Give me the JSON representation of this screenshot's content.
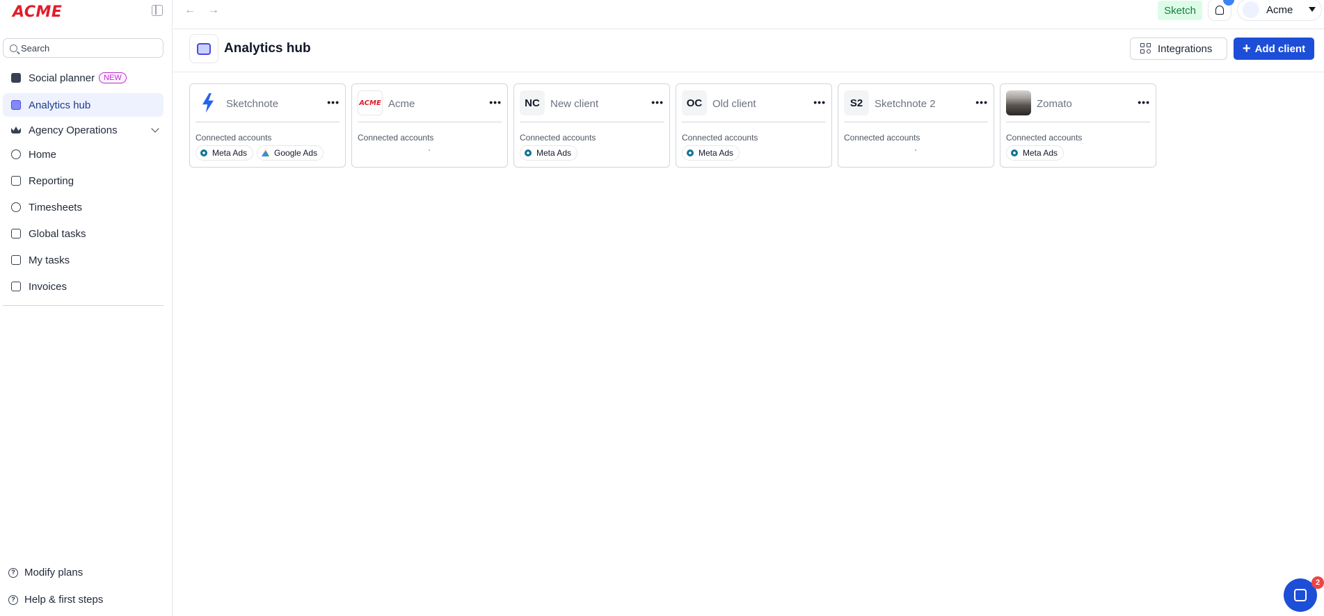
{
  "app": {
    "logo_text": "ACME",
    "brand_color": "#e11d2a",
    "accent_color": "#1d4ed8"
  },
  "sidebar": {
    "search_placeholder": "Search",
    "items": [
      {
        "label": "Social planner",
        "badge": "NEW",
        "icon": "calendar-icon"
      },
      {
        "label": "Analytics hub",
        "icon": "analytics-icon",
        "active": true
      },
      {
        "label": "Agency Operations",
        "icon": "crown-icon",
        "expandable": true
      },
      {
        "label": "Home",
        "icon": "home-icon"
      },
      {
        "label": "Reporting",
        "icon": "report-icon"
      },
      {
        "label": "Timesheets",
        "icon": "clock-icon"
      },
      {
        "label": "Global tasks",
        "icon": "tasks-icon"
      },
      {
        "label": "My tasks",
        "icon": "checklist-icon"
      },
      {
        "label": "Invoices",
        "icon": "invoice-icon"
      }
    ],
    "footer": [
      {
        "label": "Modify plans",
        "icon": "help-icon"
      },
      {
        "label": "Help & first steps",
        "icon": "help-icon"
      }
    ]
  },
  "topbar": {
    "workspace_tag": "Sketch",
    "account_name": "Acme"
  },
  "header": {
    "title": "Analytics hub",
    "integrations_label": "Integrations",
    "add_client_label": "Add client"
  },
  "clients": [
    {
      "name": "Sketchnote",
      "avatar": "logo",
      "connected_label": "Connected accounts",
      "accounts": [
        "Meta Ads",
        "Google Ads"
      ]
    },
    {
      "name": "Acme",
      "avatar": "ACME",
      "connected_label": "Connected accounts",
      "accounts": []
    },
    {
      "name": "New client",
      "avatar": "NC",
      "connected_label": "Connected accounts",
      "accounts": [
        "Meta Ads"
      ]
    },
    {
      "name": "Old client",
      "avatar": "OC",
      "connected_label": "Connected accounts",
      "accounts": [
        "Meta Ads"
      ]
    },
    {
      "name": "Sketchnote 2",
      "avatar": "S2",
      "connected_label": "Connected accounts",
      "accounts": []
    },
    {
      "name": "Zomato",
      "avatar": "photo",
      "connected_label": "Connected accounts",
      "accounts": [
        "Meta Ads"
      ]
    }
  ],
  "chat": {
    "unread_count": "2"
  }
}
